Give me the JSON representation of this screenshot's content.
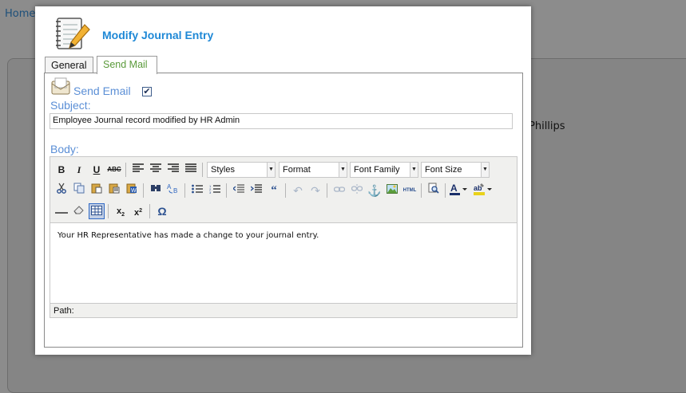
{
  "background": {
    "home_link": "Home",
    "name_fragment": "Phillips",
    "dash_fragment": "-"
  },
  "modal": {
    "title": "Modify Journal Entry",
    "tabs": [
      {
        "label": "General",
        "active": false
      },
      {
        "label": "Send Mail",
        "active": true
      }
    ],
    "send_email_label": "Send Email",
    "send_email_checked": true,
    "subject_label": "Subject:",
    "subject_value": "Employee Journal record modified by HR Admin",
    "body_label": "Body:",
    "editor": {
      "styles_select": "Styles",
      "format_select": "Format",
      "font_family_select": "Font Family",
      "font_size_select": "Font Size",
      "content": "Your HR Representative has made a change to your journal entry.",
      "path_label": "Path:"
    }
  },
  "colors": {
    "accent_title": "#1e88d6",
    "label_blue": "#5b8fd6",
    "active_tab_text": "#5a9a3a",
    "overlay": "#8c8c8c"
  }
}
